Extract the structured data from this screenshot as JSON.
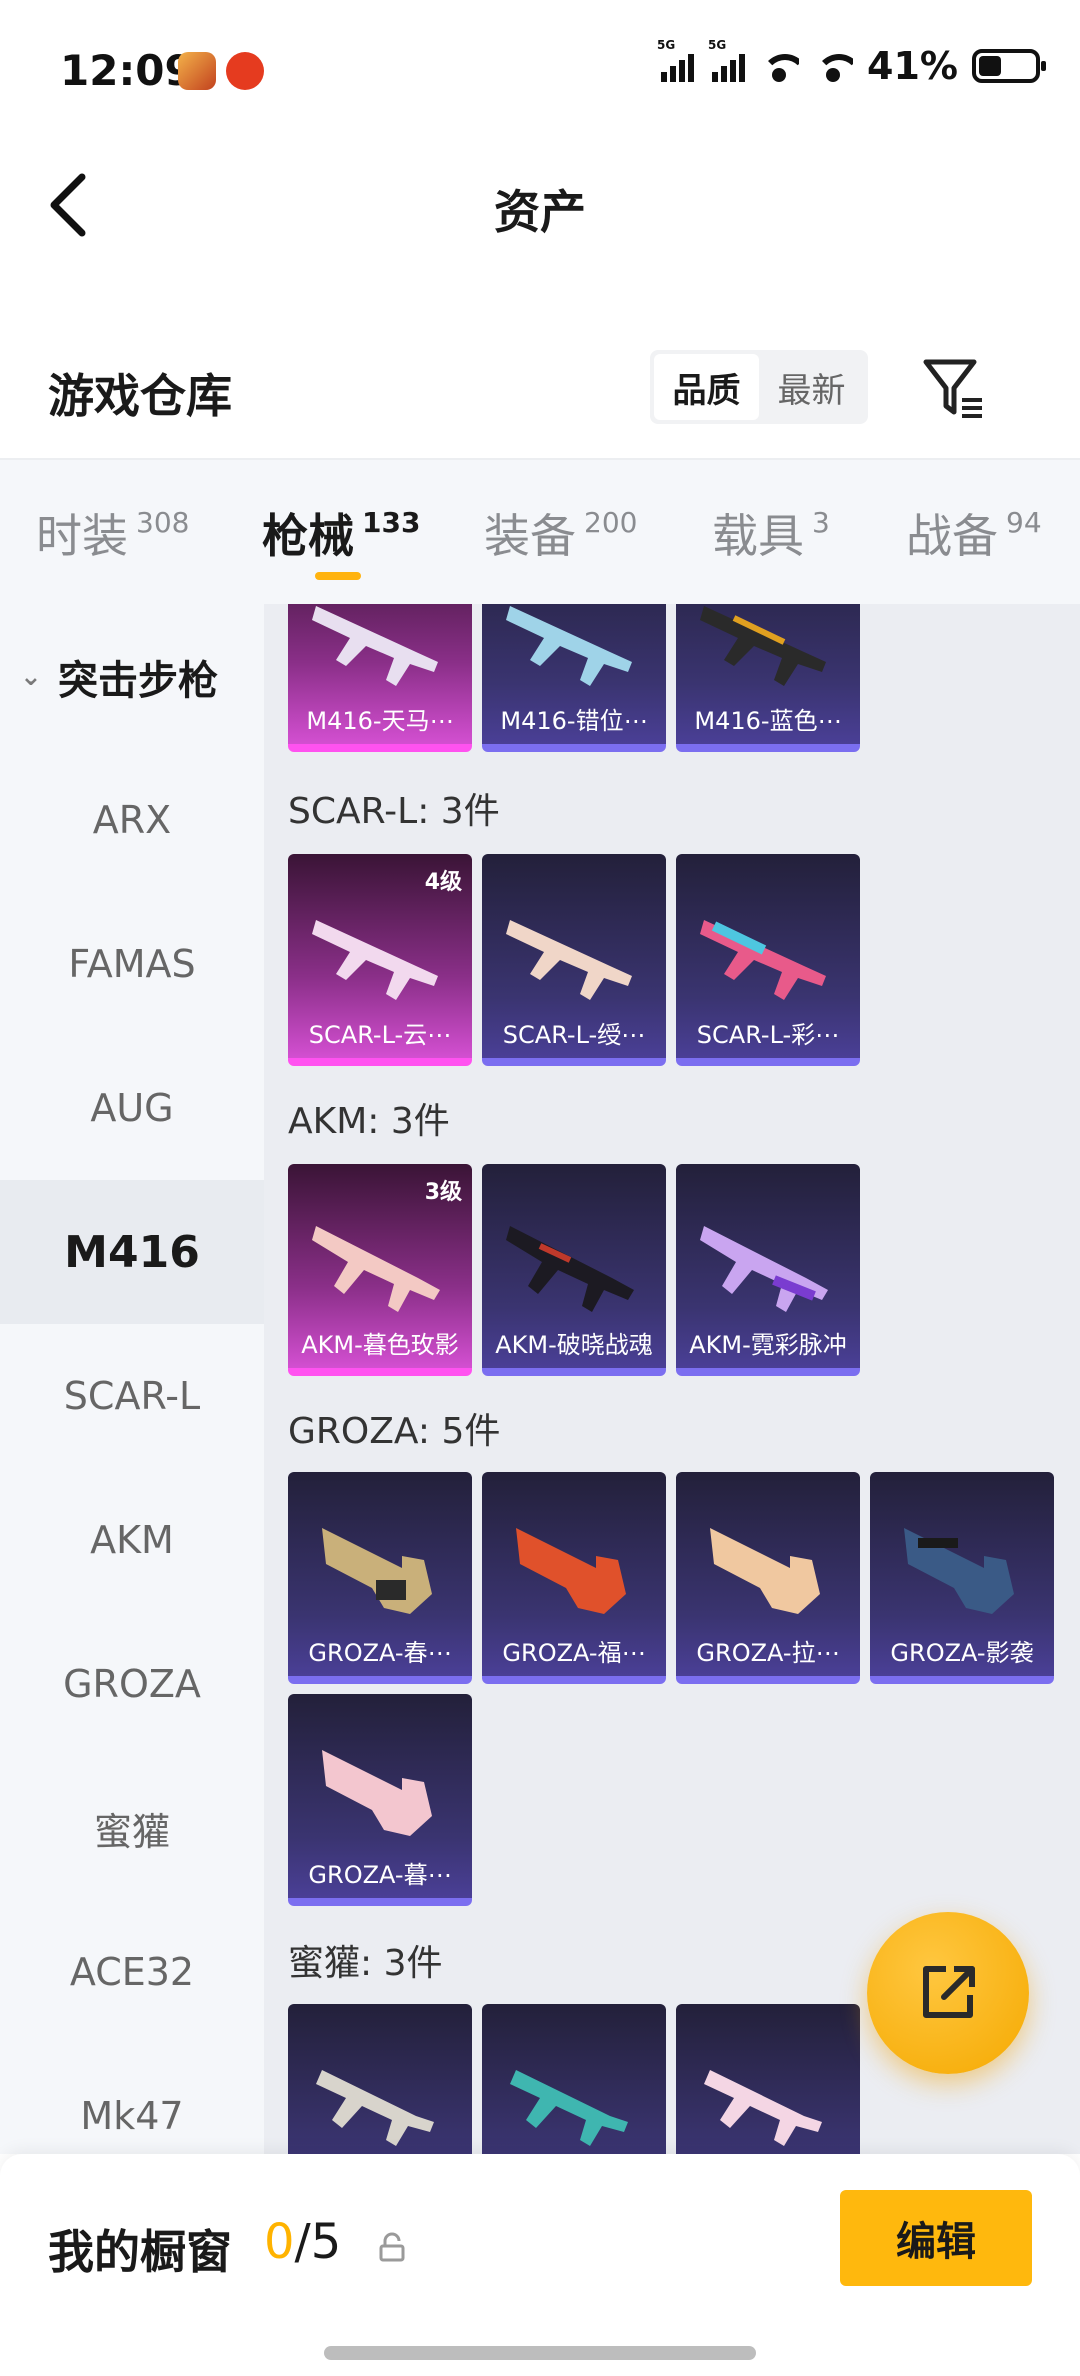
{
  "status_bar": {
    "time": "12:09",
    "battery": "41%",
    "network": [
      "5G",
      "5G"
    ],
    "icons": [
      "game-app-icon",
      "notification-app-icon",
      "signal-icon",
      "signal-icon",
      "wifi-icon",
      "wifi-icon",
      "battery-icon"
    ]
  },
  "header": {
    "title": "资产",
    "back_icon": "back-arrow-icon"
  },
  "warehouse": {
    "title": "游戏仓库",
    "sort_options": [
      "品质",
      "最新"
    ],
    "sort_selected": "品质",
    "filter_icon": "filter-icon"
  },
  "tabs": [
    {
      "label": "时装",
      "count": "308"
    },
    {
      "label": "枪械",
      "count": "133",
      "active": true
    },
    {
      "label": "装备",
      "count": "200"
    },
    {
      "label": "载具",
      "count": "3"
    },
    {
      "label": "战备",
      "count": "94"
    }
  ],
  "sidebar": {
    "group": "突击步枪",
    "items": [
      "ARX",
      "FAMAS",
      "AUG",
      "M416",
      "SCAR-L",
      "AKM",
      "GROZA",
      "蜜獾",
      "ACE32",
      "Mk47"
    ],
    "active": "M416"
  },
  "content": {
    "partial_top": [
      {
        "name": "M416-天马⋯",
        "rarity": "pink"
      },
      {
        "name": "M416-错位⋯",
        "rarity": "purple"
      },
      {
        "name": "M416-蓝色⋯",
        "rarity": "purple"
      }
    ],
    "sections": [
      {
        "label": "SCAR-L: 3件",
        "items": [
          {
            "name": "SCAR-L-云⋯",
            "rarity": "pink",
            "level": "4级"
          },
          {
            "name": "SCAR-L-绶⋯",
            "rarity": "purple"
          },
          {
            "name": "SCAR-L-彩⋯",
            "rarity": "purple"
          }
        ]
      },
      {
        "label": "AKM: 3件",
        "items": [
          {
            "name": "AKM-暮色玫影",
            "rarity": "pink",
            "level": "3级"
          },
          {
            "name": "AKM-破晓战魂",
            "rarity": "purple"
          },
          {
            "name": "AKM-霓彩脉冲",
            "rarity": "purple"
          }
        ]
      },
      {
        "label": "GROZA: 5件",
        "items": [
          {
            "name": "GROZA-春⋯",
            "rarity": "purple"
          },
          {
            "name": "GROZA-福⋯",
            "rarity": "purple"
          },
          {
            "name": "GROZA-拉⋯",
            "rarity": "purple"
          },
          {
            "name": "GROZA-影袭",
            "rarity": "purple"
          },
          {
            "name": "GROZA-暮⋯",
            "rarity": "purple"
          }
        ]
      },
      {
        "label": "蜜獾: 3件",
        "items": [
          {
            "name": "",
            "rarity": "purple"
          },
          {
            "name": "",
            "rarity": "purple"
          },
          {
            "name": "",
            "rarity": "purple"
          }
        ]
      }
    ],
    "fab_icon": "share-external-icon"
  },
  "bottom": {
    "showcase_label": "我的橱窗",
    "count_current": "0",
    "count_sep_total": "/5",
    "lock_icon": "lock-icon",
    "edit_label": "编辑"
  },
  "colors": {
    "accent": "#ffb80d",
    "card_purple": "#4a3f96",
    "card_pink": "#d34fd1",
    "sidebar_bg": "#f5f7fa",
    "content_bg": "#ebedf2"
  }
}
